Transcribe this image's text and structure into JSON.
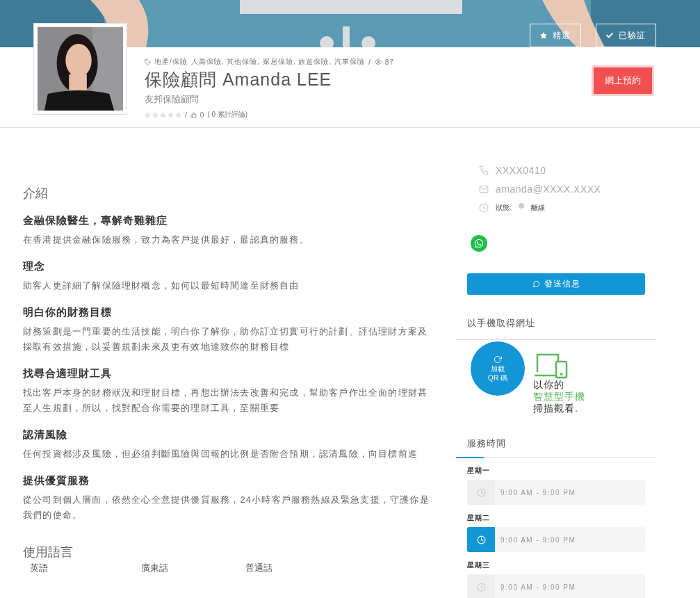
{
  "header": {
    "badges": [
      {
        "kind": "star",
        "label": "精選"
      },
      {
        "kind": "check",
        "label": "已驗証"
      }
    ],
    "category": "地產/保險",
    "tags": "人壽保險, 其他保險, 家居保險, 旅遊保險, 汽車保險",
    "views_separator": "/",
    "views": "87",
    "title": "保險顧問 Amanda LEE",
    "subtitle": "友邦保險顧問",
    "stars": 0,
    "rating_separator": "/",
    "likes": "0",
    "reviews": "( 0  累計評論)",
    "book_button": "網上預約"
  },
  "intro": {
    "title": "介紹",
    "sections": [
      {
        "heading": "金融保險醫生，專解奇難雜症",
        "text": "在香港提供金融保險服務，致力為客戶提供最好，最認真的服務。"
      },
      {
        "heading": "理念",
        "text": "助客人更詳細了解保險理財概念，如何以最短時間達至財務自由"
      },
      {
        "heading": "明白你的財務目標",
        "text": "財務策劃是一門重要的生活技能，明白你了解你，助你訂立切實可行的計劃、評估理財方案及採取有效措施，以妥善規劃未來及更有效地達致你的財務目標"
      },
      {
        "heading": "找尋合適理財工具",
        "text": "找出客戶本身的財務狀況和理財目標，再想出辦法去改善和完成，幫助客戶作出全面的理財甚至人生規劃，所以，找對配合你需要的理財工具，至關重要"
      },
      {
        "heading": "認清風險",
        "text": "任何投資都涉及風險，但必須判斷風險與回報的比例是否附合預期，認清風險，向目標前進"
      },
      {
        "heading": "提供優質服務",
        "text": "從公司到個人層面，依然全心全意提供優質服務，24小時客戶服務熱線及緊急支援，守護你是我們的使命。"
      }
    ]
  },
  "languages": {
    "title": "使用語言",
    "items": [
      "英語",
      "廣東話",
      "普通話"
    ]
  },
  "contact": {
    "phone": "XXXX0410",
    "email": "amanda@XXXX.XXXX",
    "status_label": "狀態:",
    "online": false,
    "status": "離線",
    "send_button": "發送信息"
  },
  "qr": {
    "title": "以手機取得網址",
    "button_line1": "加載",
    "button_line2": "QR 碼",
    "line1": "以你的",
    "line2": "智慧型手機",
    "line3": "掃描觀看."
  },
  "hours": {
    "title": "服務時間",
    "days": [
      {
        "day": "星期一",
        "time": "9:00 AM - 9:00 PM",
        "selected": false
      },
      {
        "day": "星期二",
        "time": "9:00 AM - 9:00 PM",
        "selected": true
      },
      {
        "day": "星期三",
        "time": "9:00 AM - 9:00 PM",
        "selected": false
      }
    ]
  }
}
